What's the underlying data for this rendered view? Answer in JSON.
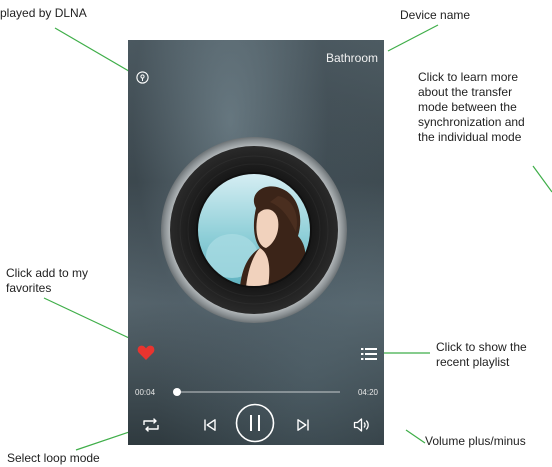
{
  "annotations": {
    "dlna": "played by DLNA",
    "device_name": "Device name",
    "transfer_mode": [
      "Click to learn more",
      "about the transfer",
      "mode between the",
      "synchronization and",
      "the individual mode"
    ],
    "favorite": [
      "Click add to my",
      "favorites"
    ],
    "playlist": [
      "Click to show the",
      "recent playlist"
    ],
    "loop": "Select loop mode",
    "volume": "Volume plus/minus"
  },
  "player": {
    "device_name": "Bathroom",
    "current_time": "00:04",
    "total_time": "04:20",
    "progress": 0.02,
    "favorited": true,
    "state": "playing"
  },
  "icons": {
    "dlna": "dlna-icon",
    "favorite": "heart-icon",
    "playlist": "playlist-icon",
    "loop": "repeat-icon",
    "previous": "previous-track-icon",
    "pause": "pause-icon",
    "next": "next-track-icon",
    "volume": "volume-icon"
  },
  "colors": {
    "favorite": "#e8342f",
    "leader_lines": "#3fae49"
  }
}
